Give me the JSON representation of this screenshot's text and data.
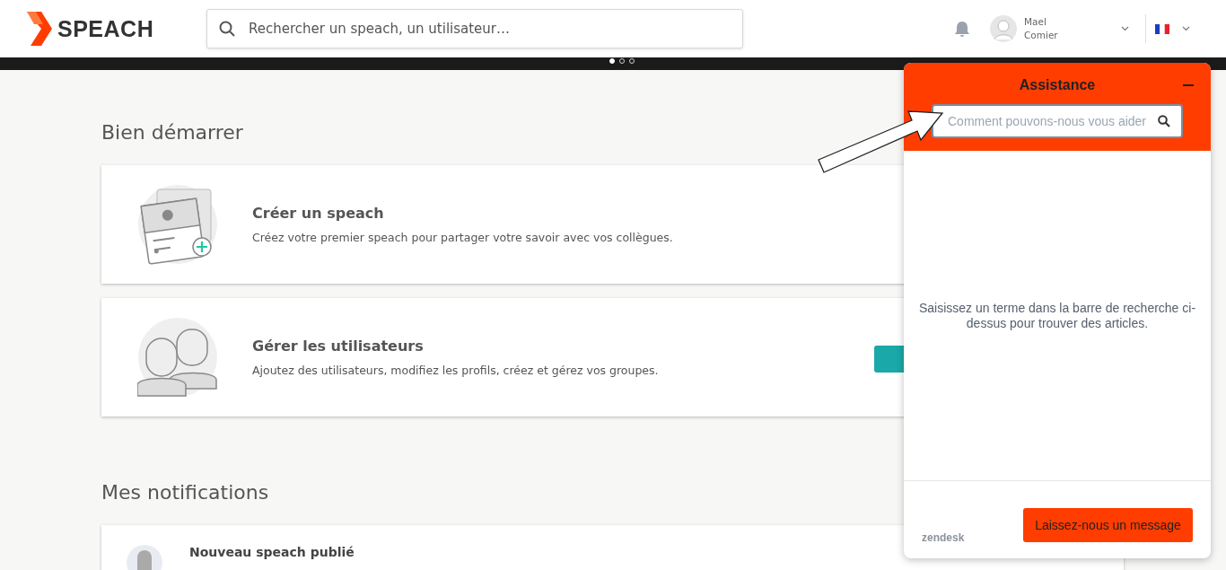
{
  "header": {
    "logo": "SPEACH",
    "search": {
      "placeholder": "Rechercher un speach, un utilisateur…"
    },
    "user": {
      "first_name": "Mael",
      "last_name": "Comier"
    },
    "carousel_dots": [
      {
        "selected": true
      },
      {
        "selected": false
      },
      {
        "selected": false
      }
    ]
  },
  "getting_started": {
    "title": "Bien démarrer",
    "cards": [
      {
        "kind": "speach",
        "title": "Créer un speach",
        "description": "Créez votre premier speach pour partager votre savoir avec vos collègues."
      },
      {
        "kind": "users",
        "title": "Gérer les utilisateurs",
        "description": "Ajoutez des utilisateurs, modifiez les profils, créez et gérez vos groupes."
      }
    ]
  },
  "notifications": {
    "title": "Mes notifications",
    "items": [
      {
        "title": "Nouveau speach publié"
      }
    ]
  },
  "help_widget": {
    "title": "Assistance",
    "search": {
      "placeholder": "Comment pouvons-nous vous aider"
    },
    "message": "Saisissez un terme dans la barre de recherche ci-dessus pour trouver des articles.",
    "branding": "zendesk",
    "button": "Laissez-nous un message"
  }
}
